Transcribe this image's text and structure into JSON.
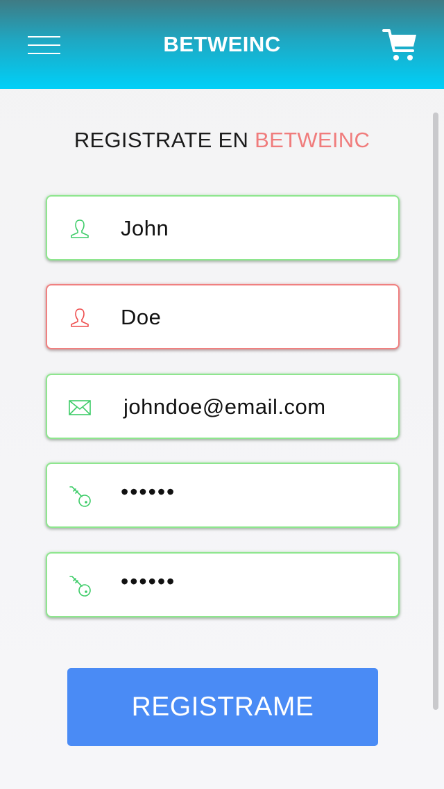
{
  "header": {
    "title": "BETWEINC",
    "menu_icon": "hamburger-menu-icon",
    "cart_icon": "shopping-cart-icon"
  },
  "heading": {
    "prefix": "REGISTRATE EN ",
    "brand": "BETWEINC"
  },
  "form": {
    "first_name": {
      "value": "John",
      "icon": "user-icon",
      "state": "valid"
    },
    "last_name": {
      "value": "Doe",
      "icon": "user-icon",
      "state": "error"
    },
    "email": {
      "value": "johndoe@email.com",
      "icon": "mail-icon",
      "state": "valid"
    },
    "password": {
      "value": "••••••",
      "icon": "key-icon",
      "state": "valid"
    },
    "confirm_password": {
      "value": "••••••",
      "icon": "key-icon",
      "state": "valid"
    }
  },
  "submit": {
    "label": "REGISTRAME"
  },
  "colors": {
    "header_top": "#3f7b84",
    "header_bottom": "#00d0f8",
    "brand_accent": "#f07c7c",
    "valid_border": "#8ee68e",
    "error_border": "#f08080",
    "button": "#4a8bf5"
  }
}
